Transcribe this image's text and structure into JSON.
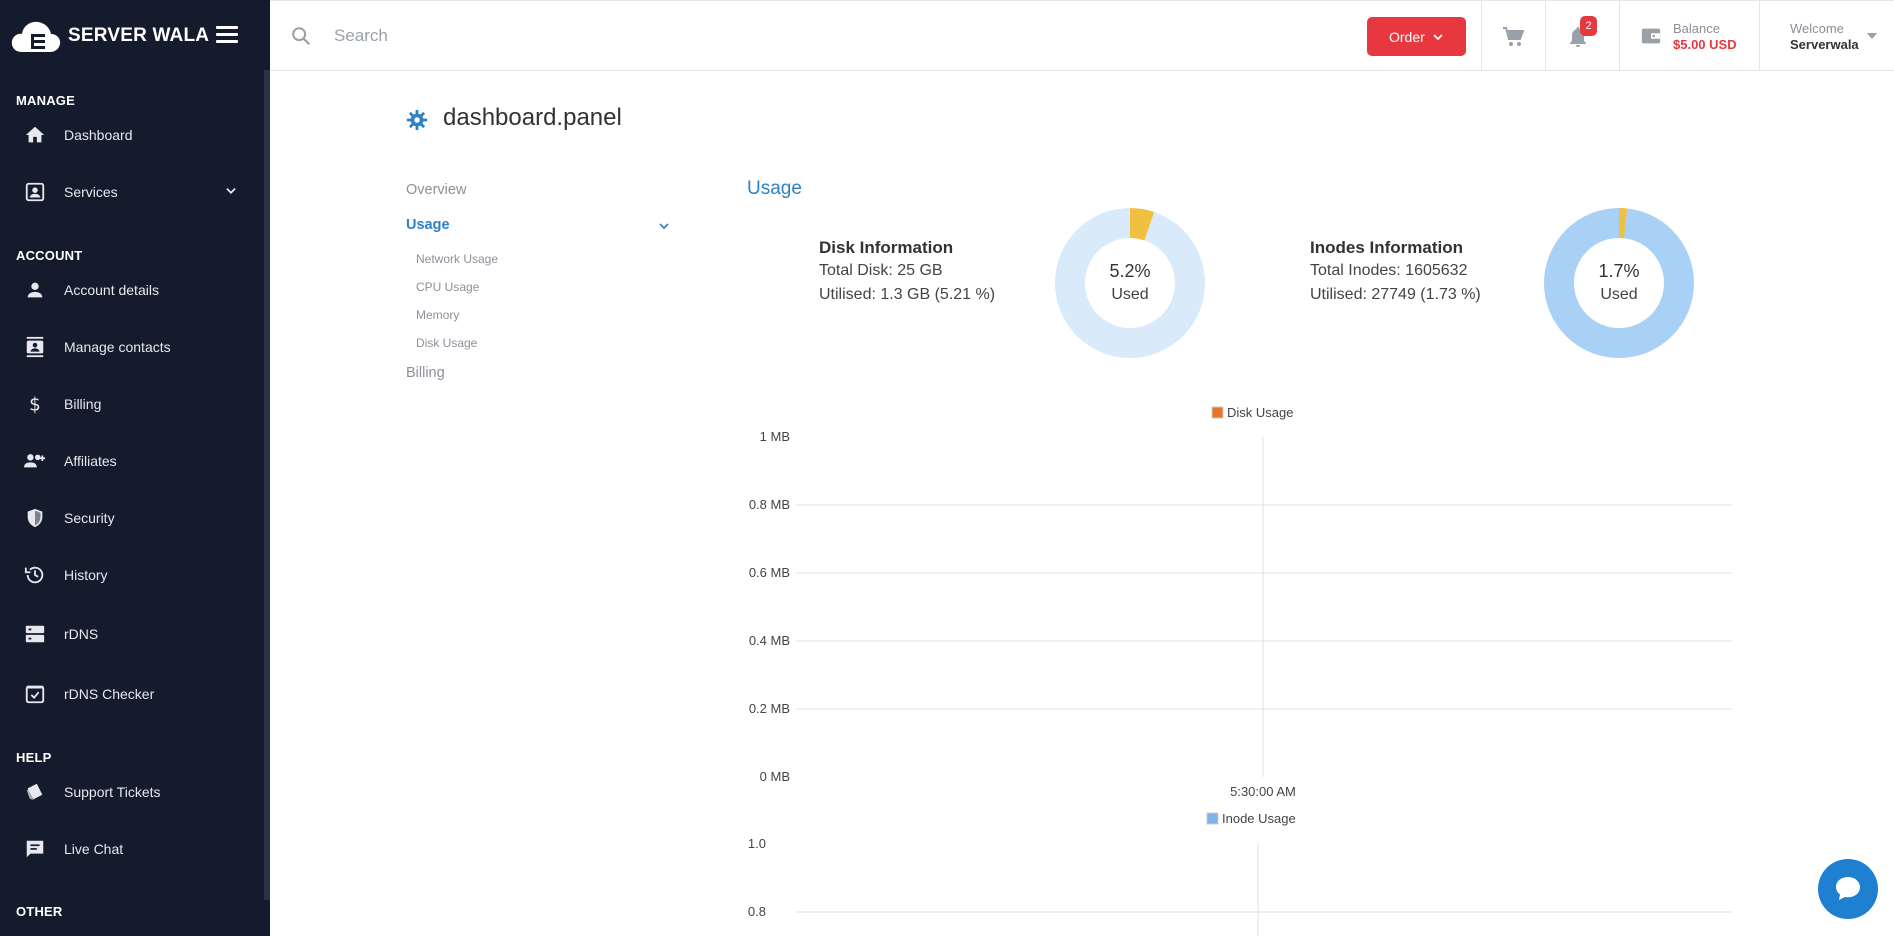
{
  "brand": {
    "name": "SERVER WALA"
  },
  "sidebar": {
    "sections": [
      {
        "title": "MANAGE"
      },
      {
        "title": "ACCOUNT"
      },
      {
        "title": "HELP"
      },
      {
        "title": "OTHER"
      }
    ],
    "items": [
      {
        "label": "Dashboard",
        "icon": "home-icon"
      },
      {
        "label": "Services",
        "icon": "services-icon"
      },
      {
        "label": "Account details",
        "icon": "person-icon"
      },
      {
        "label": "Manage contacts",
        "icon": "contacts-icon"
      },
      {
        "label": "Billing",
        "icon": "dollar-icon"
      },
      {
        "label": "Affiliates",
        "icon": "affiliates-icon"
      },
      {
        "label": "Security",
        "icon": "shield-icon"
      },
      {
        "label": "History",
        "icon": "history-icon"
      },
      {
        "label": "rDNS",
        "icon": "server-icon"
      },
      {
        "label": "rDNS Checker",
        "icon": "checkbox-icon"
      },
      {
        "label": "Support Tickets",
        "icon": "ticket-icon"
      },
      {
        "label": "Live Chat",
        "icon": "chat-icon"
      }
    ]
  },
  "topbar": {
    "search_placeholder": "Search",
    "order_label": "Order",
    "notification_count": "2",
    "balance_label": "Balance",
    "balance_value": "$5.00 USD",
    "welcome_label": "Welcome",
    "welcome_user": "Serverwala"
  },
  "page": {
    "title": "dashboard.panel",
    "subnav": {
      "overview": "Overview",
      "usage": "Usage",
      "network_usage": "Network Usage",
      "cpu_usage": "CPU Usage",
      "memory": "Memory",
      "disk_usage": "Disk Usage",
      "billing": "Billing"
    },
    "usage_heading": "Usage",
    "disk": {
      "title": "Disk Information",
      "total": "Total Disk: 25 GB",
      "utilised": "Utilised: 1.3 GB (5.21 %)",
      "pct": "5.2%",
      "used_label": "Used",
      "fraction": 0.0521
    },
    "inodes": {
      "title": "Inodes Information",
      "total": "Total Inodes: 1605632",
      "utilised": "Utilised: 27749 (1.73 %)",
      "pct": "1.7%",
      "used_label": "Used",
      "fraction": 0.0173
    }
  },
  "colors": {
    "sidebar_bg": "#141b2d",
    "accent_blue": "#2f80c4",
    "accent_red": "#e8383f",
    "donut_used": "#f0c040",
    "disk_donut_bg": "#d9eafa",
    "inode_donut_bg": "#a9d1f5",
    "disk_legend": "#e8742a",
    "inode_legend": "#7fb1ea"
  },
  "chart_data": [
    {
      "type": "line",
      "legend": "Disk Usage",
      "y_ticks": [
        "1 MB",
        "0.8 MB",
        "0.6 MB",
        "0.4 MB",
        "0.2 MB",
        "0 MB"
      ],
      "x_ticks": [
        "5:30:00 AM"
      ],
      "ylim": [
        0,
        1
      ],
      "grid": true,
      "series": [
        {
          "name": "Disk Usage",
          "values": []
        }
      ]
    },
    {
      "type": "line",
      "legend": "Inode Usage",
      "y_ticks": [
        "1.0",
        "0.8"
      ],
      "ylim": [
        0,
        1
      ],
      "grid": true,
      "series": [
        {
          "name": "Inode Usage",
          "values": []
        }
      ]
    }
  ]
}
